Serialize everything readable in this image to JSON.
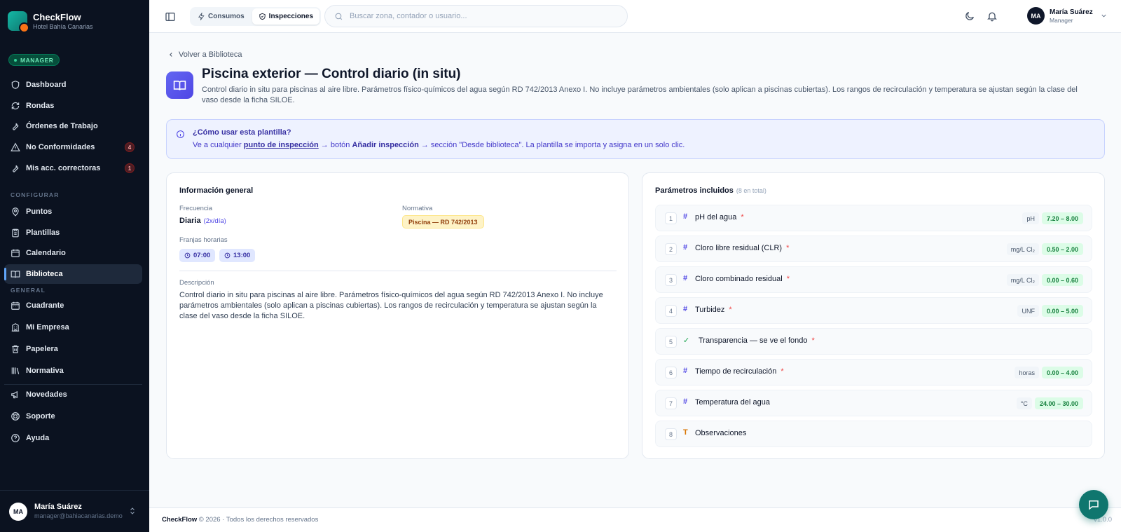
{
  "sidebar": {
    "brand_name": "CheckFlow",
    "brand_sub": "Hotel Bahía Canarias",
    "role": "MANAGER",
    "items_main": [
      {
        "label": "Dashboard"
      },
      {
        "label": "Rondas"
      },
      {
        "label": "Órdenes de Trabajo"
      },
      {
        "label": "No Conformidades",
        "badge": "4"
      },
      {
        "label": "Mis acc. correctoras",
        "badge": "1"
      }
    ],
    "section_configurar": "CONFIGURAR",
    "items_config": [
      {
        "label": "Puntos"
      },
      {
        "label": "Plantillas"
      },
      {
        "label": "Calendario"
      },
      {
        "label": "Biblioteca",
        "active": true
      }
    ],
    "section_general": "GENERAL",
    "items_general": [
      {
        "label": "Cuadrante"
      },
      {
        "label": "Mi Empresa"
      },
      {
        "label": "Papelera"
      },
      {
        "label": "Normativa"
      }
    ],
    "items_extra": [
      {
        "label": "Novedades"
      },
      {
        "label": "Soporte"
      },
      {
        "label": "Ayuda"
      }
    ],
    "user": {
      "initials": "MA",
      "name": "María Suárez",
      "email": "manager@bahiacanarias.demo"
    }
  },
  "topbar": {
    "tabs": [
      {
        "label": "Consumos",
        "icon": "bolt-icon"
      },
      {
        "label": "Inspecciones",
        "icon": "shield-check-icon",
        "active": true
      }
    ],
    "search_placeholder": "Buscar zona, contador o usuario...",
    "user": {
      "initials": "MA",
      "name": "María Suárez",
      "role": "Manager"
    }
  },
  "main": {
    "back_label": "Volver a Biblioteca",
    "title": "Piscina exterior — Control diario (in situ)",
    "description": "Control diario in situ para piscinas al aire libre. Parámetros físico-químicos del agua según RD 742/2013 Anexo I. No incluye parámetros ambientales (solo aplican a piscinas cubiertas). Los rangos de recirculación y temperatura se ajustan según la clase del vaso desde la ficha SILOE.",
    "info": {
      "title": "¿Cómo usar esta plantilla?",
      "pre": "Ve a cualquier ",
      "link": "punto de inspección",
      "mid1": " → botón ",
      "action": "Añadir inspección",
      "mid2": " → sección \"Desde biblioteca\". La plantilla se importa y asigna en un solo clic."
    },
    "general": {
      "title": "Información general",
      "freq_label": "Frecuencia",
      "freq_value": "Diaria",
      "freq_sub": "(2x/día)",
      "norm_label": "Normativa",
      "norm_value": "Piscina — RD 742/2013",
      "slots_label": "Franjas horarias",
      "slots": [
        "07:00",
        "13:00"
      ],
      "desc_label": "Descripción",
      "desc_value": "Control diario in situ para piscinas al aire libre. Parámetros físico-químicos del agua según RD 742/2013 Anexo I. No incluye parámetros ambientales (solo aplican a piscinas cubiertas). Los rangos de recirculación y temperatura se ajustan según la clase del vaso desde la ficha SILOE."
    },
    "params": {
      "title": "Parámetros incluidos",
      "count": "(8 en total)",
      "items": [
        {
          "n": "1",
          "type": "numeric",
          "name": "pH del agua",
          "required": true,
          "unit": "pH",
          "range": "7.20 – 8.00"
        },
        {
          "n": "2",
          "type": "numeric",
          "name": "Cloro libre residual (CLR)",
          "required": true,
          "unit": "mg/L Cl₂",
          "range": "0.50 – 2.00"
        },
        {
          "n": "3",
          "type": "numeric",
          "name": "Cloro combinado residual",
          "required": true,
          "unit": "mg/L Cl₂",
          "range": "0.00 – 0.60"
        },
        {
          "n": "4",
          "type": "numeric",
          "name": "Turbidez",
          "required": true,
          "unit": "UNF",
          "range": "0.00 – 5.00"
        },
        {
          "n": "5",
          "type": "check",
          "name": "Transparencia — se ve el fondo",
          "required": true,
          "unit": "",
          "range": ""
        },
        {
          "n": "6",
          "type": "numeric",
          "name": "Tiempo de recirculación",
          "required": true,
          "unit": "horas",
          "range": "0.00 – 4.00"
        },
        {
          "n": "7",
          "type": "numeric",
          "name": "Temperatura del agua",
          "required": false,
          "unit": "°C",
          "range": "24.00 – 30.00"
        },
        {
          "n": "8",
          "type": "text",
          "name": "Observaciones",
          "required": false,
          "unit": "",
          "range": ""
        }
      ]
    }
  },
  "footer": {
    "brand": "CheckFlow",
    "text": " © 2026 · Todos los derechos reservados",
    "version": "v1.0.0"
  },
  "colors": {
    "accent": "#4f46e5",
    "sidebar_bg": "#0b1220",
    "fab": "#0f766e"
  }
}
